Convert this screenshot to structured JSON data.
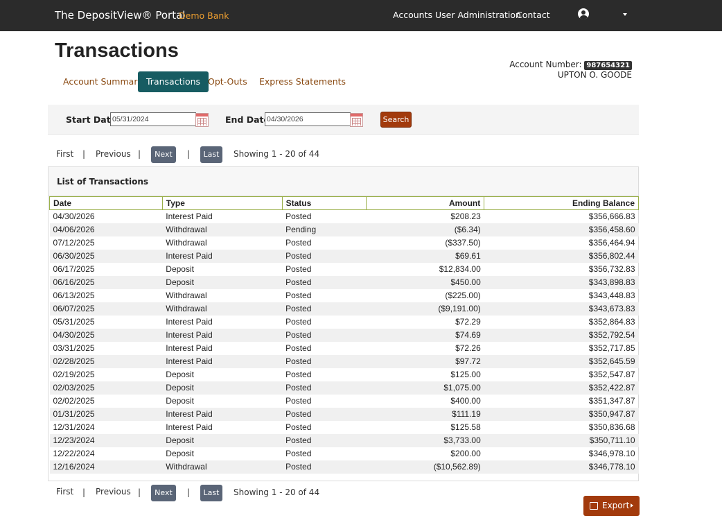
{
  "header": {
    "brand": "The DepositView® Portal",
    "bank": "Demo Bank",
    "nav": [
      "Accounts",
      "User Administration",
      "Contact"
    ],
    "user_icon": "user-circle-icon"
  },
  "page": {
    "title": "Transactions",
    "account_label": "Account Number:",
    "account_number": "987654321",
    "account_holder": "UPTON O. GOODE"
  },
  "tabs": [
    {
      "label": "Account Summary",
      "active": false
    },
    {
      "label": "Transactions",
      "active": true
    },
    {
      "label": "Opt-Outs",
      "active": false
    },
    {
      "label": "Express Statements",
      "active": false
    }
  ],
  "filter": {
    "start_label": "Start Date",
    "start_value": "05/31/2024",
    "end_label": "End Date",
    "end_value": "04/30/2026",
    "search_label": "Search",
    "calendar_icon": "calendar-icon"
  },
  "pager": {
    "first": "First",
    "previous": "Previous",
    "next": "Next",
    "last": "Last",
    "separator": "|",
    "info": "Showing 1 - 20 of 44"
  },
  "list": {
    "title": "List of Transactions",
    "columns": [
      "Date",
      "Type",
      "Status",
      "Amount",
      "Ending Balance"
    ],
    "rows": [
      [
        "04/30/2026",
        "Interest Paid",
        "Posted",
        "$208.23",
        "$356,666.83"
      ],
      [
        "04/06/2026",
        "Withdrawal",
        "Pending",
        "($6.34)",
        "$356,458.60"
      ],
      [
        "07/12/2025",
        "Withdrawal",
        "Posted",
        "($337.50)",
        "$356,464.94"
      ],
      [
        "06/30/2025",
        "Interest Paid",
        "Posted",
        "$69.61",
        "$356,802.44"
      ],
      [
        "06/17/2025",
        "Deposit",
        "Posted",
        "$12,834.00",
        "$356,732.83"
      ],
      [
        "06/16/2025",
        "Deposit",
        "Posted",
        "$450.00",
        "$343,898.83"
      ],
      [
        "06/13/2025",
        "Withdrawal",
        "Posted",
        "($225.00)",
        "$343,448.83"
      ],
      [
        "06/07/2025",
        "Withdrawal",
        "Posted",
        "($9,191.00)",
        "$343,673.83"
      ],
      [
        "05/31/2025",
        "Interest Paid",
        "Posted",
        "$72.29",
        "$352,864.83"
      ],
      [
        "04/30/2025",
        "Interest Paid",
        "Posted",
        "$74.69",
        "$352,792.54"
      ],
      [
        "03/31/2025",
        "Interest Paid",
        "Posted",
        "$72.26",
        "$352,717.85"
      ],
      [
        "02/28/2025",
        "Interest Paid",
        "Posted",
        "$97.72",
        "$352,645.59"
      ],
      [
        "02/19/2025",
        "Deposit",
        "Posted",
        "$125.00",
        "$352,547.87"
      ],
      [
        "02/03/2025",
        "Deposit",
        "Posted",
        "$1,075.00",
        "$352,422.87"
      ],
      [
        "02/02/2025",
        "Deposit",
        "Posted",
        "$400.00",
        "$351,347.87"
      ],
      [
        "01/31/2025",
        "Interest Paid",
        "Posted",
        "$111.19",
        "$350,947.87"
      ],
      [
        "12/31/2024",
        "Interest Paid",
        "Posted",
        "$125.58",
        "$350,836.68"
      ],
      [
        "12/23/2024",
        "Deposit",
        "Posted",
        "$3,733.00",
        "$350,711.10"
      ],
      [
        "12/22/2024",
        "Deposit",
        "Posted",
        "$200.00",
        "$346,978.10"
      ],
      [
        "12/16/2024",
        "Withdrawal",
        "Posted",
        "($10,562.89)",
        "$346,778.10"
      ]
    ]
  },
  "export": {
    "label": "Export",
    "icon": "export-icon"
  },
  "colors": {
    "topbar": "#2b2b2b",
    "bank_accent": "#f0a030",
    "active_tab": "#175c62",
    "action_button": "#a23a0c",
    "pager_button": "#5a6577",
    "table_header_border": "#9ab04a"
  }
}
